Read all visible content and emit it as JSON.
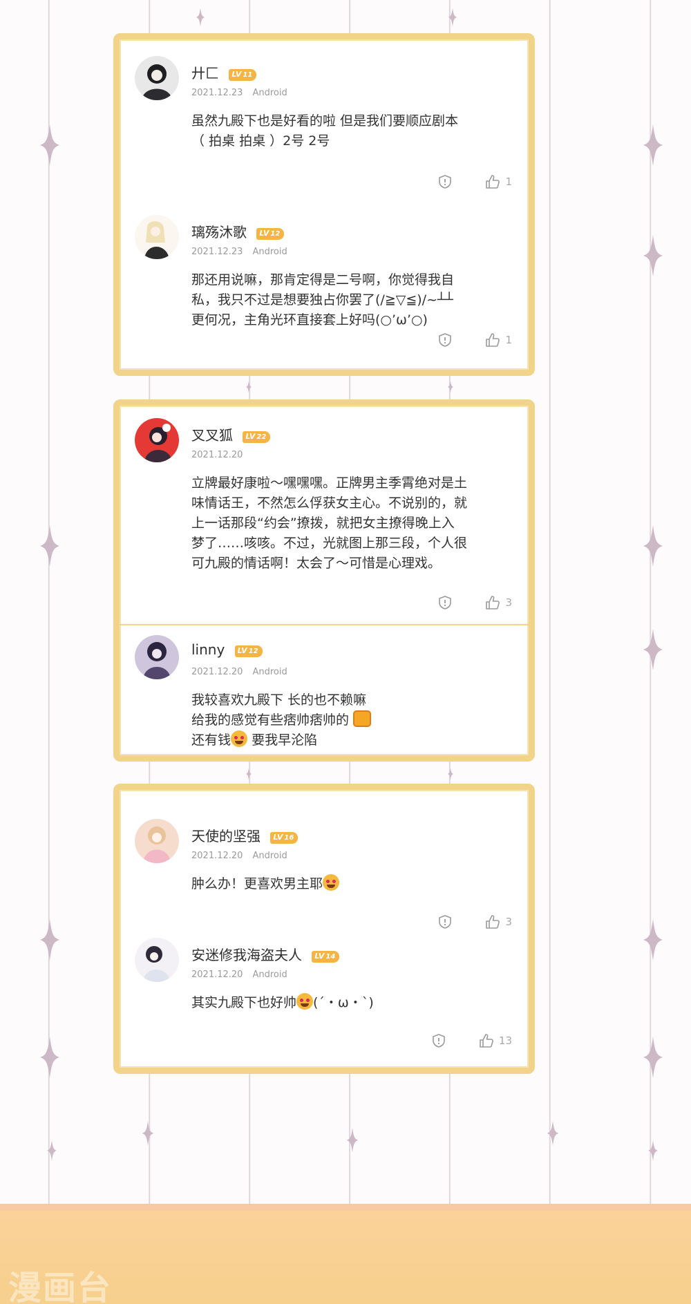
{
  "comments_group_1": [
    {
      "username": "廾匚",
      "level": "11",
      "date": "2021.12.23",
      "device": "Android",
      "lines": [
        "虽然九殿下也是好看的啦 但是我们要顺应剧本",
        "（ 拍桌 拍桌 ）2号 2号"
      ],
      "likes": "1"
    },
    {
      "username": "璃殇沐歌",
      "level": "12",
      "date": "2021.12.23",
      "device": "Android",
      "lines": [
        "那还用说嘛，那肯定得是二号啊，你觉得我自",
        "私，我只不过是想要独占你罢了(/≧▽≦)/~┴┴",
        "更何况，主角光环直接套上好吗(○’ω’○)"
      ],
      "likes": "1"
    }
  ],
  "comments_group_2": [
    {
      "username": "叉叉狐",
      "level": "22",
      "date": "2021.12.20",
      "device": "",
      "lines": [
        "立牌最好康啦～嘿嘿嘿。正牌男主季霄绝对是土",
        "味情话王，不然怎么俘获女主心。不说别的，就",
        "上一话那段“约会”撩拨，就把女主撩得晚上入",
        "梦了……咳咳。不过，光就图上那三段，个人很",
        "可九殿的情话啊！太会了～可惜是心理戏。"
      ],
      "likes": "3"
    },
    {
      "username": "linny",
      "level": "12",
      "date": "2021.12.20",
      "device": "Android",
      "lines": [
        "我较喜欢九殿下 长的也不赖嘛",
        "给我的感觉有些痞帅痞帅的",
        "还有钱",
        "要我早沦陷"
      ]
    }
  ],
  "comments_group_3": [
    {
      "username": "天使的坚强",
      "level": "16",
      "date": "2021.12.20",
      "device": "Android",
      "lines": [
        "肿么办！更喜欢男主耶"
      ],
      "likes": "3"
    },
    {
      "username": "安迷修我海盗夫人",
      "level": "14",
      "date": "2021.12.20",
      "device": "Android",
      "lines": [
        "其实九殿下也好帅",
        "(´・ω・`)"
      ],
      "likes": "13"
    }
  ],
  "badge_prefix": "LV",
  "watermark": "漫画台",
  "colors": {
    "card_border": "#f1d489",
    "badge": "#f4b544",
    "bottom_band": "#f6d08c"
  },
  "icons": {
    "report": "report-icon",
    "like": "thumbs-up-icon"
  }
}
